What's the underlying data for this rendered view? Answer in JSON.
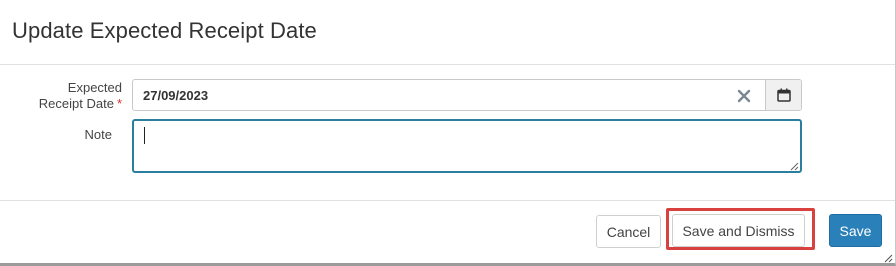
{
  "dialog": {
    "title": "Update Expected Receipt Date"
  },
  "form": {
    "expected_date": {
      "label_line1": "Expected",
      "label_line2": "Receipt Date",
      "required_marker": "*",
      "value": "27/09/2023",
      "clear_icon": "close-icon",
      "calendar_icon": "calendar-icon"
    },
    "note": {
      "label": "Note",
      "value": ""
    }
  },
  "footer": {
    "cancel_label": "Cancel",
    "save_dismiss_label": "Save and Dismiss",
    "save_label": "Save"
  },
  "colors": {
    "primary": "#2a80b9",
    "focus_border": "#2a7f9e",
    "required": "#d9302c",
    "highlight": "#d9413e"
  }
}
